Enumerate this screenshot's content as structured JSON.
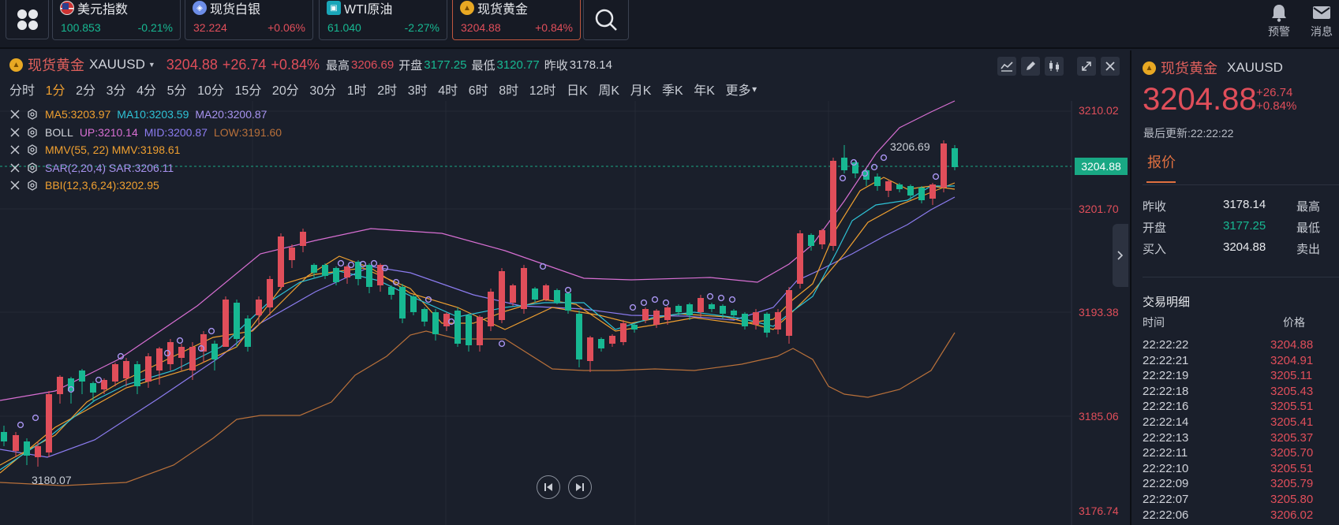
{
  "topbar": {
    "tickers": [
      {
        "name": "美元指数",
        "price": "100.853",
        "change": "-0.21%",
        "trend": "down",
        "icon": "us-flag-icon"
      },
      {
        "name": "现货白银",
        "price": "32.224",
        "change": "+0.06%",
        "trend": "up",
        "icon": "silver-coin-icon"
      },
      {
        "name": "WTI原油",
        "price": "61.040",
        "change": "-2.27%",
        "trend": "down",
        "icon": "oil-icon"
      },
      {
        "name": "现货黄金",
        "price": "3204.88",
        "change": "+0.84%",
        "trend": "up",
        "icon": "gold-coin-icon"
      }
    ],
    "alert_label": "预警",
    "message_label": "消息"
  },
  "symbol": {
    "name": "现货黄金",
    "code": "XAUUSD",
    "price": "3204.88",
    "change": "+26.74",
    "change_pct": "+0.84%",
    "high_label": "最高",
    "high": "3206.69",
    "open_label": "开盘",
    "open": "3177.25",
    "low_label": "最低",
    "low": "3120.77",
    "prev_close_label": "昨收",
    "prev_close": "3178.14"
  },
  "periods": [
    "分时",
    "1分",
    "2分",
    "3分",
    "4分",
    "5分",
    "10分",
    "15分",
    "20分",
    "30分",
    "1时",
    "2时",
    "3时",
    "4时",
    "6时",
    "8时",
    "12时",
    "日K",
    "周K",
    "月K",
    "季K",
    "年K",
    "更多"
  ],
  "active_period": "1分",
  "indicators": {
    "ma": {
      "ma5": "MA5:3203.97",
      "ma10": "MA10:3203.59",
      "ma20": "MA20:3200.87"
    },
    "boll": {
      "name": "BOLL",
      "up": "UP:3210.14",
      "mid": "MID:3200.87",
      "low": "LOW:3191.60"
    },
    "mmv": {
      "text": "MMV(55, 22) MMV:3198.61"
    },
    "sar": {
      "text": "SAR(2,20,4) SAR:3206.11"
    },
    "bbi": {
      "text": "BBI(12,3,6,24):3202.95"
    }
  },
  "price_axis": [
    "3210.02",
    "3201.70",
    "3193.38",
    "3185.06",
    "3176.74"
  ],
  "current_price_tag": "3204.88",
  "annotations": {
    "high_mark": "3206.69",
    "low_mark": "3180.07"
  },
  "colors": {
    "up": "#e04e5a",
    "down": "#17b892",
    "ma5": "#f0a030",
    "ma10": "#2fc3d6",
    "ma20": "#8c7cf0",
    "boll_up": "#d86fd3",
    "boll_low": "#b8703a",
    "accent": "#e07040"
  },
  "quote_panel": {
    "name": "现货黄金",
    "code": "XAUUSD",
    "price": "3204.88",
    "change": "+26.74",
    "change_pct": "+0.84%",
    "update_time": "最后更新:22:22:22",
    "tab_label": "报价",
    "rows": [
      {
        "label": "昨收",
        "value": "3178.14",
        "right_label": "最高",
        "trend": "flat"
      },
      {
        "label": "开盘",
        "value": "3177.25",
        "right_label": "最低",
        "trend": "down"
      },
      {
        "label": "买入",
        "value": "3204.88",
        "right_label": "卖出",
        "trend": "flat"
      }
    ],
    "trades_title": "交易明细",
    "time_header": "时间",
    "price_header": "价格",
    "trades": [
      {
        "time": "22:22:22",
        "price": "3204.88"
      },
      {
        "time": "22:22:21",
        "price": "3204.91"
      },
      {
        "time": "22:22:19",
        "price": "3205.11"
      },
      {
        "time": "22:22:18",
        "price": "3205.43"
      },
      {
        "time": "22:22:16",
        "price": "3205.51"
      },
      {
        "time": "22:22:14",
        "price": "3205.41"
      },
      {
        "time": "22:22:13",
        "price": "3205.37"
      },
      {
        "time": "22:22:11",
        "price": "3205.70"
      },
      {
        "time": "22:22:10",
        "price": "3205.51"
      },
      {
        "time": "22:22:09",
        "price": "3205.79"
      },
      {
        "time": "22:22:07",
        "price": "3205.80"
      },
      {
        "time": "22:22:06",
        "price": "3206.02"
      }
    ]
  }
}
